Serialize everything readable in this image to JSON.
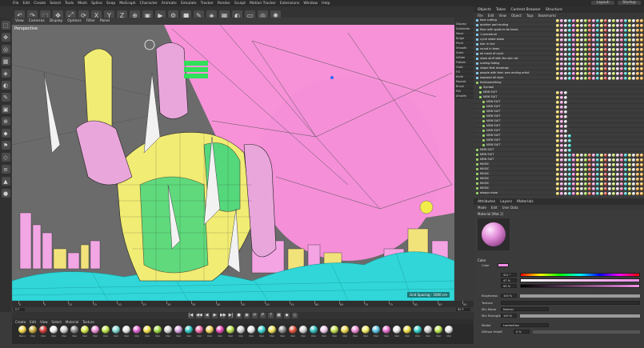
{
  "menu": {
    "items": [
      "File",
      "Edit",
      "Create",
      "Select",
      "Tools",
      "Mesh",
      "Spline",
      "Snap",
      "MoGraph",
      "Character",
      "Animate",
      "Simulate",
      "Tracker",
      "Render",
      "Sculpt",
      "Motion Tracker",
      "Extensions",
      "Window",
      "Help"
    ],
    "layout_label": "Layout:",
    "layout_value": "Startup"
  },
  "toolbar": {
    "icons": [
      "undo",
      "redo",
      "select",
      "move",
      "scale",
      "rotate",
      "x-axis",
      "y-axis",
      "z-axis",
      "coord",
      "render-view",
      "render",
      "edit-render",
      "cube",
      "pen",
      "subdiv",
      "array",
      "deform",
      "floor",
      "camera",
      "light"
    ]
  },
  "viewport": {
    "menu": [
      "View",
      "Cameras",
      "Display",
      "Options",
      "Filter",
      "Panel"
    ],
    "label": "Perspective",
    "badge": "Grid Spacing : 1000 cm",
    "colors": {
      "sky": "#f792d8",
      "ground": "#6b6b6b",
      "cyan": "#30d6d8",
      "yellow": "#f3f07a",
      "green": "#2fd37f"
    }
  },
  "viewport_tools": [
    "Display",
    "Subdivide",
    "Move",
    "Bulge",
    "Pinch",
    "Smooth",
    "Scale",
    "Inflate",
    "Flatten",
    "Grab",
    "Fill",
    "Knife",
    "Repeat",
    "Brush",
    "Pull",
    "Amplify",
    "Mask",
    "Erase"
  ],
  "timeline": {
    "ticks": [
      "0",
      "5",
      "10",
      "15",
      "20",
      "25",
      "30",
      "35",
      "40",
      "45",
      "50",
      "55",
      "60",
      "65",
      "70",
      "75",
      "80",
      "85",
      "90"
    ],
    "start": "0 F",
    "end": "90 F",
    "current": "0 F"
  },
  "transport": [
    "|◀",
    "◀◀",
    "◀",
    "▶",
    "▶▶",
    "▶|",
    "●",
    "◉",
    "⟳",
    "P",
    "?",
    "▣",
    "◆",
    "◇"
  ],
  "materials": {
    "menu": [
      "Create",
      "Edit",
      "View",
      "Select",
      "Material",
      "Texture"
    ],
    "items": [
      {
        "name": "Mat.1",
        "color": "#f1d44a"
      },
      {
        "name": "Mat",
        "color": "#c8a93a"
      },
      {
        "name": "Mat",
        "color": "#d43a3a"
      },
      {
        "name": "Mat",
        "color": "#ededed"
      },
      {
        "name": "Mat",
        "color": "#cfcfcf"
      },
      {
        "name": "Mat",
        "color": "#8b8b8b"
      },
      {
        "name": "Mat",
        "color": "#d8e84a"
      },
      {
        "name": "Mat",
        "color": "#ef8fd9"
      },
      {
        "name": "Mat",
        "color": "#bde647"
      },
      {
        "name": "Mat",
        "color": "#7fd9d4"
      },
      {
        "name": "Mat",
        "color": "#e3e3e3"
      },
      {
        "name": "Mat",
        "color": "#df63d2"
      },
      {
        "name": "Mat",
        "color": "#f2e24b"
      },
      {
        "name": "Mat",
        "color": "#9dd93d"
      },
      {
        "name": "Mat",
        "color": "#d5d5d5"
      },
      {
        "name": "Mat",
        "color": "#d7a4e0"
      },
      {
        "name": "Mat",
        "color": "#2ec7c5"
      },
      {
        "name": "Mat",
        "color": "#f06ca8"
      },
      {
        "name": "Mat",
        "color": "#f0d25a"
      },
      {
        "name": "Mat",
        "color": "#e84ab6"
      },
      {
        "name": "Mat",
        "color": "#b8e04a"
      },
      {
        "name": "Mat",
        "color": "#cfcfcf"
      },
      {
        "name": "Mat",
        "color": "#e6e6e6"
      },
      {
        "name": "Mat",
        "color": "#3dd3cf"
      },
      {
        "name": "Mat",
        "color": "#efe254"
      },
      {
        "name": "Mat",
        "color": "#8c8c8c"
      },
      {
        "name": "Mat",
        "color": "#e5533c"
      },
      {
        "name": "Mat",
        "color": "#d4d4d4"
      },
      {
        "name": "Mat",
        "color": "#31c0bf"
      },
      {
        "name": "Mat",
        "color": "#efc9ec"
      },
      {
        "name": "Mat",
        "color": "#c6e24d"
      },
      {
        "name": "Mat",
        "color": "#f1d64d"
      },
      {
        "name": "Mat",
        "color": "#ef8fd6"
      },
      {
        "name": "Mat",
        "color": "#f5ec63"
      },
      {
        "name": "Mat",
        "color": "#5cc5e3"
      },
      {
        "name": "Mat",
        "color": "#e96fcf"
      },
      {
        "name": "Mat",
        "color": "#e8e8e8"
      },
      {
        "name": "Mat",
        "color": "#f1df4a"
      },
      {
        "name": "Mat",
        "color": "#31cfcb"
      },
      {
        "name": "Mat",
        "color": "#cdcdcd"
      },
      {
        "name": "Mat",
        "color": "#b9e34b"
      },
      {
        "name": "Mat",
        "color": "#e4e4e4"
      }
    ]
  },
  "object_manager": {
    "tabs": [
      "Objects",
      "Takes",
      "Content Browser",
      "Structure"
    ],
    "menu": [
      "File",
      "Edit",
      "View",
      "Object",
      "Tags",
      "Bookmarks"
    ],
    "rows": [
      {
        "name": "face cutting",
        "dot": "#8ad0ff",
        "depth": 0
      },
      {
        "name": "another part ending",
        "dot": "#8ad0ff",
        "depth": 0
      },
      {
        "name": "floor with spots to be faces",
        "dot": "#8ad0ff",
        "depth": 0
      },
      {
        "name": "1 procedure",
        "dot": "#8ad0ff",
        "depth": 0
      },
      {
        "name": "cycle skate stoke",
        "dot": "#8ad0ff",
        "depth": 0
      },
      {
        "name": "hair in line",
        "dot": "#8ad0ff",
        "depth": 0
      },
      {
        "name": "round in town",
        "dot": "#8ad0ff",
        "depth": 0
      },
      {
        "name": "all mesh of cycle",
        "dot": "#8ad0ff",
        "depth": 0
      },
      {
        "name": "show stuff with the skin rot",
        "dot": "#8ad0ff",
        "depth": 0
      },
      {
        "name": "scaling fading",
        "dot": "#8ad0ff",
        "depth": 0
      },
      {
        "name": "shape that drawings",
        "dot": "#8ad0ff",
        "depth": 0
      },
      {
        "name": "people with their own ending artist",
        "dot": "#8ad0ff",
        "depth": 0
      },
      {
        "name": "exposed all style",
        "dot": "#8ad0ff",
        "depth": 0
      },
      {
        "name": "Null/something",
        "dot": "#9bd66a",
        "depth": 0
      },
      {
        "name": "Symbol",
        "dot": "#9bd66a",
        "depth": 1
      },
      {
        "name": "NEW SUIT",
        "dot": "#9bd66a",
        "depth": 1
      },
      {
        "name": "NEW SUIT",
        "dot": "#9bd66a",
        "depth": 1
      },
      {
        "name": "NEW SUIT",
        "dot": "#9bd66a",
        "depth": 2
      },
      {
        "name": "NEW SUIT",
        "dot": "#9bd66a",
        "depth": 2
      },
      {
        "name": "NEW SUIT",
        "dot": "#9bd66a",
        "depth": 2
      },
      {
        "name": "NEW SUIT",
        "dot": "#9bd66a",
        "depth": 2
      },
      {
        "name": "NEW SUIT",
        "dot": "#9bd66a",
        "depth": 2
      },
      {
        "name": "NEW SUIT",
        "dot": "#9bd66a",
        "depth": 2
      },
      {
        "name": "NEW SUIT",
        "dot": "#9bd66a",
        "depth": 2
      },
      {
        "name": "NEW SUIT",
        "dot": "#9bd66a",
        "depth": 2
      },
      {
        "name": "NEW SUIT",
        "dot": "#9bd66a",
        "depth": 2
      },
      {
        "name": "NEW SUIT",
        "dot": "#9bd66a",
        "depth": 2
      },
      {
        "name": "NEW SUIT",
        "dot": "#9bd66a",
        "depth": 0
      },
      {
        "name": "NEW SUIT",
        "dot": "#9bd66a",
        "depth": 0
      },
      {
        "name": "NEW SUIT",
        "dot": "#9bd66a",
        "depth": 0
      },
      {
        "name": "MUSIC",
        "dot": "#9bd66a",
        "depth": 0
      },
      {
        "name": "MUSIC",
        "dot": "#9bd66a",
        "depth": 0
      },
      {
        "name": "MUSIC",
        "dot": "#9bd66a",
        "depth": 0
      },
      {
        "name": "MUSIC",
        "dot": "#9bd66a",
        "depth": 0
      },
      {
        "name": "MUSIC",
        "dot": "#9bd66a",
        "depth": 0
      },
      {
        "name": "MUSIC",
        "dot": "#9bd66a",
        "depth": 0
      },
      {
        "name": "always more",
        "dot": "#9bd66a",
        "depth": 0
      }
    ]
  },
  "attribute_manager": {
    "tabs": [
      "Attributes",
      "Layers",
      "Materials"
    ],
    "menu": [
      "Mode",
      "Edit",
      "User Data"
    ],
    "title": "Material [Mat.1]",
    "color_section": "Color",
    "color_label": "Color",
    "brightness_label": "Brightness",
    "brightness_value": "100 %",
    "texture_label": "Texture",
    "mix_mode_label": "Mix Mode",
    "mix_mode_value": "Normal",
    "mix_strength_label": "Mix Strength",
    "mix_strength_value": "100 %",
    "model_label": "Model",
    "model_value": "Lambertian",
    "diffuse_label": "Diffuse Falloff",
    "diffuse_value": "0 %",
    "h_value": "321 °",
    "s_value": "47 %",
    "v_value": "95 %",
    "swatch_color": "#f18ee6"
  }
}
